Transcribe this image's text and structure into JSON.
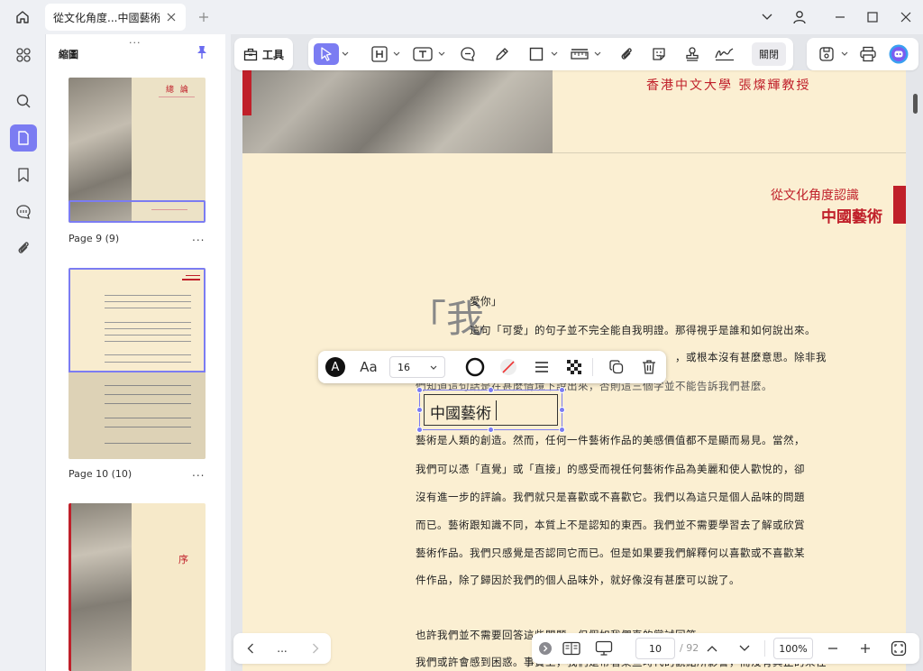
{
  "titlebar": {
    "tab_title": "從文化角度...中國藝術*"
  },
  "panel": {
    "title": "縮圖",
    "grip": "...",
    "pages": [
      {
        "label": "Page 9 (9)",
        "more": "...",
        "heading": "總 論"
      },
      {
        "label": "Page 10 (10)",
        "more": "..."
      },
      {
        "heading": "序"
      }
    ]
  },
  "toolbar": {
    "tools_label": "工具",
    "close_label": "關閉"
  },
  "document": {
    "professor": "香港中文大學 張燦輝教授",
    "subtitle_small": "從文化角度認識",
    "subtitle_big": "中國藝術",
    "quote_mark": "「我",
    "lines": [
      "愛你」",
      "這句「可愛」的句子並不完全能自我明證。那得視乎是誰和如何說出來。",
      "，或根本沒有甚麼意思。除非我",
      "們知道這句話是在甚麼情境下說出來，否則這三個字並不能告訴我們甚麼。",
      "藝術是人類的創造。然而，任何一件藝術作品的美感價值都不是顯而易見。當然，",
      "我們可以憑「直覺」或「直接」的感受而視任何藝術作品為美麗和使人歡悅的，卻",
      "沒有進一步的評論。我們就只是喜歡或不喜歡它。我們以為這只是個人品味的問題",
      "而已。藝術跟知識不同，本質上不是認知的東西。我們並不需要學習去了解或欣賞",
      "藝術作品。我們只感覺是否認同它而已。但是如果要我們解釋何以喜歡或不喜歡某",
      "件作品，除了歸因於我們的個人品味外，就好像沒有甚麼可以說了。",
      "也許我們並不需要回答這些問題，但假如我們真的嘗試回答，",
      "我們或許會感到困惑。事實上，我們是帶著某些時代的觀點所影響，而沒有真正的來往"
    ],
    "textbox_value": "中國藝術"
  },
  "float_toolbar": {
    "font_glyph": "A",
    "font_style": "Aa",
    "font_size": "16"
  },
  "statusbar": {
    "nav_more": "...",
    "page_current": "10",
    "page_total": "/ 92",
    "zoom": "100%"
  },
  "colors": {
    "accent": "#7b7cf2",
    "brand_red": "#c0202a",
    "paper": "#fbefd2"
  }
}
